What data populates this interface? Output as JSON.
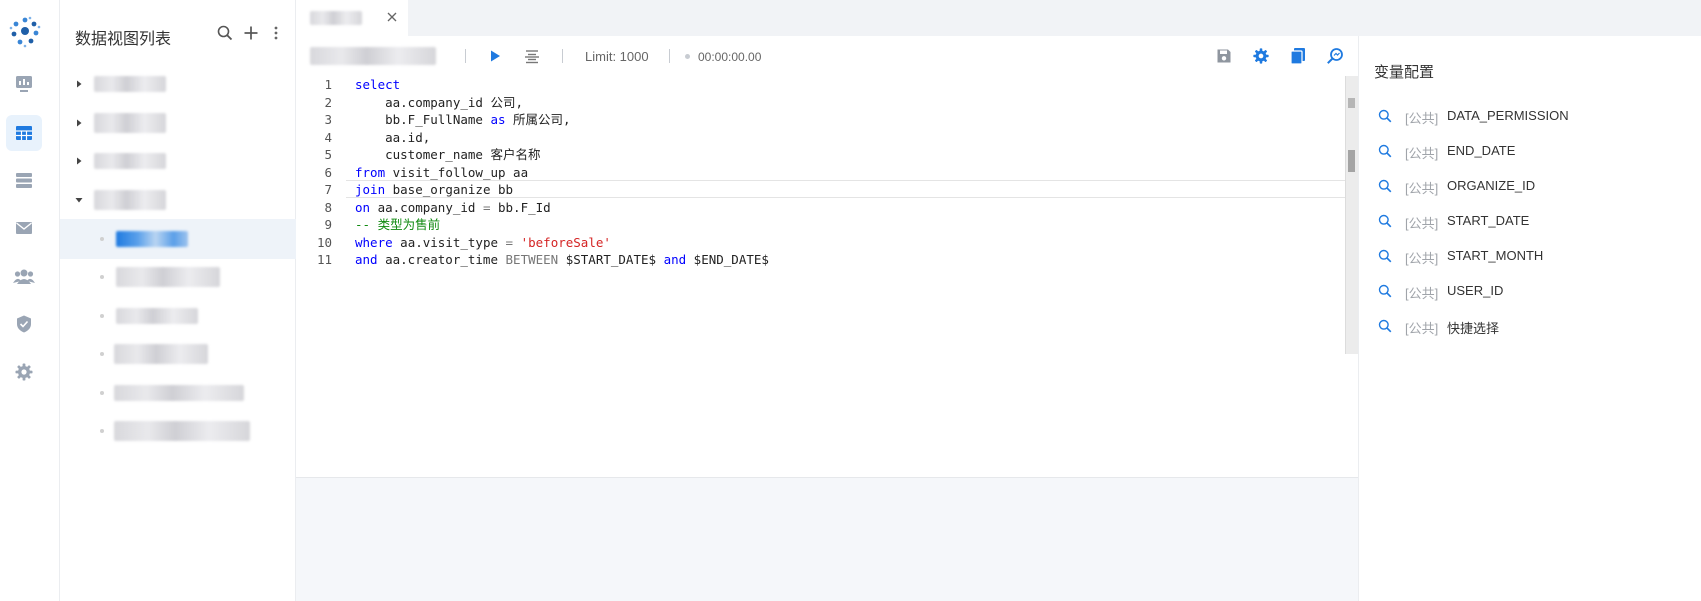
{
  "tree": {
    "title": "数据视图列表"
  },
  "tabs": {
    "active_label": "数据视图"
  },
  "toolbar": {
    "limit_label": "Limit: 1000",
    "timer": "00:00:00.00"
  },
  "editor": {
    "line_numbers": [
      "1",
      "2",
      "3",
      "4",
      "5",
      "6",
      "7",
      "8",
      "9",
      "10",
      "11"
    ]
  },
  "variables": {
    "title": "变量配置",
    "items": [
      {
        "tag": "[公共]",
        "name": "DATA_PERMISSION"
      },
      {
        "tag": "[公共]",
        "name": "END_DATE"
      },
      {
        "tag": "[公共]",
        "name": "ORGANIZE_ID"
      },
      {
        "tag": "[公共]",
        "name": "START_DATE"
      },
      {
        "tag": "[公共]",
        "name": "START_MONTH"
      },
      {
        "tag": "[公共]",
        "name": "USER_ID"
      },
      {
        "tag": "[公共]",
        "name": "快捷选择"
      }
    ]
  },
  "colors": {
    "accent": "#1f7ae0",
    "keyword": "#0000ff",
    "string": "#d42424",
    "comment": "#108a10"
  }
}
